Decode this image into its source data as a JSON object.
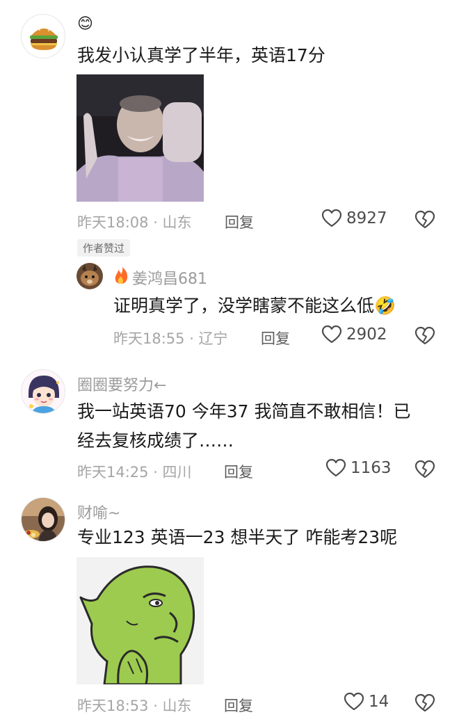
{
  "comments": [
    {
      "username": "",
      "name_emoji": "😊",
      "text": "我发小认真学了半年，英语17分",
      "time_location": "昨天18:08 · 山东",
      "reply_label": "回复",
      "likes": "8927",
      "author_badge": "作者赞过",
      "reply": {
        "username": "姜鸿昌681",
        "text": "证明真学了，没学瞎蒙不能这么低",
        "text_emoji": "🤣",
        "time_location": "昨天18:55 · 辽宁",
        "reply_label": "回复",
        "likes": "2902"
      }
    },
    {
      "username": "圈圈要努力←",
      "text_line1": "我一站英语70 今年37 我简直不敢相信！已",
      "text_line2": "经去复核成绩了……",
      "time_location": "昨天14:25 · 四川",
      "reply_label": "回复",
      "likes": "1163"
    },
    {
      "username": "财喻~",
      "text": "专业123 英语一23 想半天了 咋能考23呢",
      "time_location": "昨天18:53 · 山东",
      "reply_label": "回复",
      "likes": "14"
    }
  ],
  "icons": {
    "like": "heart-outline-icon",
    "dislike": "broken-heart-icon"
  },
  "colors": {
    "meta": "#a5a5a5",
    "text": "#1a1a1a",
    "badge_bg": "#f1f1f1",
    "green_meme": "#9dcb4f"
  }
}
